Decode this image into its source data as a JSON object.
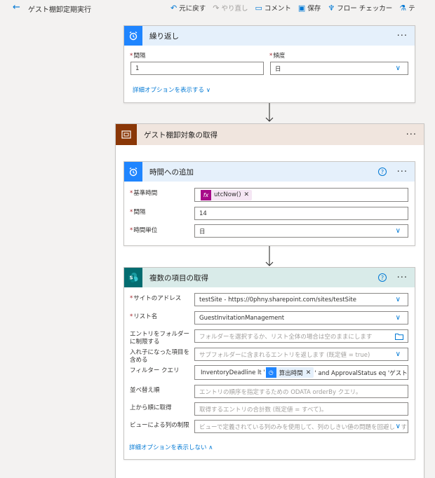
{
  "header": {
    "title": "ゲスト棚卸定期実行",
    "commands": {
      "undo": "元に戻す",
      "redo": "やり直し",
      "comment": "コメント",
      "save": "保存",
      "flow_checker": "フロー チェッカー",
      "test": "テ"
    }
  },
  "recurrence": {
    "title": "繰り返し",
    "interval_label": "間隔",
    "interval_value": "1",
    "frequency_label": "頻度",
    "frequency_value": "日",
    "advanced_link": "詳細オプションを表示する",
    "accent": "#1f85ff"
  },
  "scope": {
    "title": "ゲスト棚卸対象の取得",
    "accent": "#8a3707",
    "header_bg": "#f0e5de"
  },
  "add_to_time": {
    "title": "時間への追加",
    "base_time_label": "基準時間",
    "base_time_token": "utcNow()",
    "interval_label": "間隔",
    "interval_value": "14",
    "unit_label": "時間単位",
    "unit_value": "日",
    "header_bg": "#e5f0fb"
  },
  "get_items": {
    "title": "複数の項目の取得",
    "header_bg": "#d9ebe9",
    "accent": "#036c70",
    "site_label": "サイトのアドレス",
    "site_value": "testSite - https://0phny.sharepoint.com/sites/testSite",
    "list_label": "リスト名",
    "list_value": "GuestInvitationManagement",
    "folder_label_1": "エントリをフォルダー",
    "folder_label_2": "に制限する",
    "folder_placeholder": "フォルダーを選択するか、リスト全体の場合は空のままにします",
    "nested_label_1": "入れ子になった項目を",
    "nested_label_2": "含める",
    "nested_placeholder": "サブフォルダーに含まれるエントリを返します (既定値 = true)",
    "filter_label": "フィルター クエリ",
    "filter_prefix": "InventoryDeadline lt '",
    "filter_token": "算出時間",
    "filter_suffix": "' and ApprovalStatus eq 'ゲスト'",
    "orderby_label": "並べ替え順",
    "orderby_placeholder": "エントリの順序を指定するための ODATA orderBy クエリ。",
    "top_label": "上から順に取得",
    "top_placeholder": "取得するエントリの合計数 (既定値 = すべて)。",
    "view_label": "ビューによる列の制限",
    "view_placeholder": "ビューで定義されている列のみを使用して、列のしきい値の問題を回避します",
    "hide_link": "詳細オプションを表示しない"
  }
}
